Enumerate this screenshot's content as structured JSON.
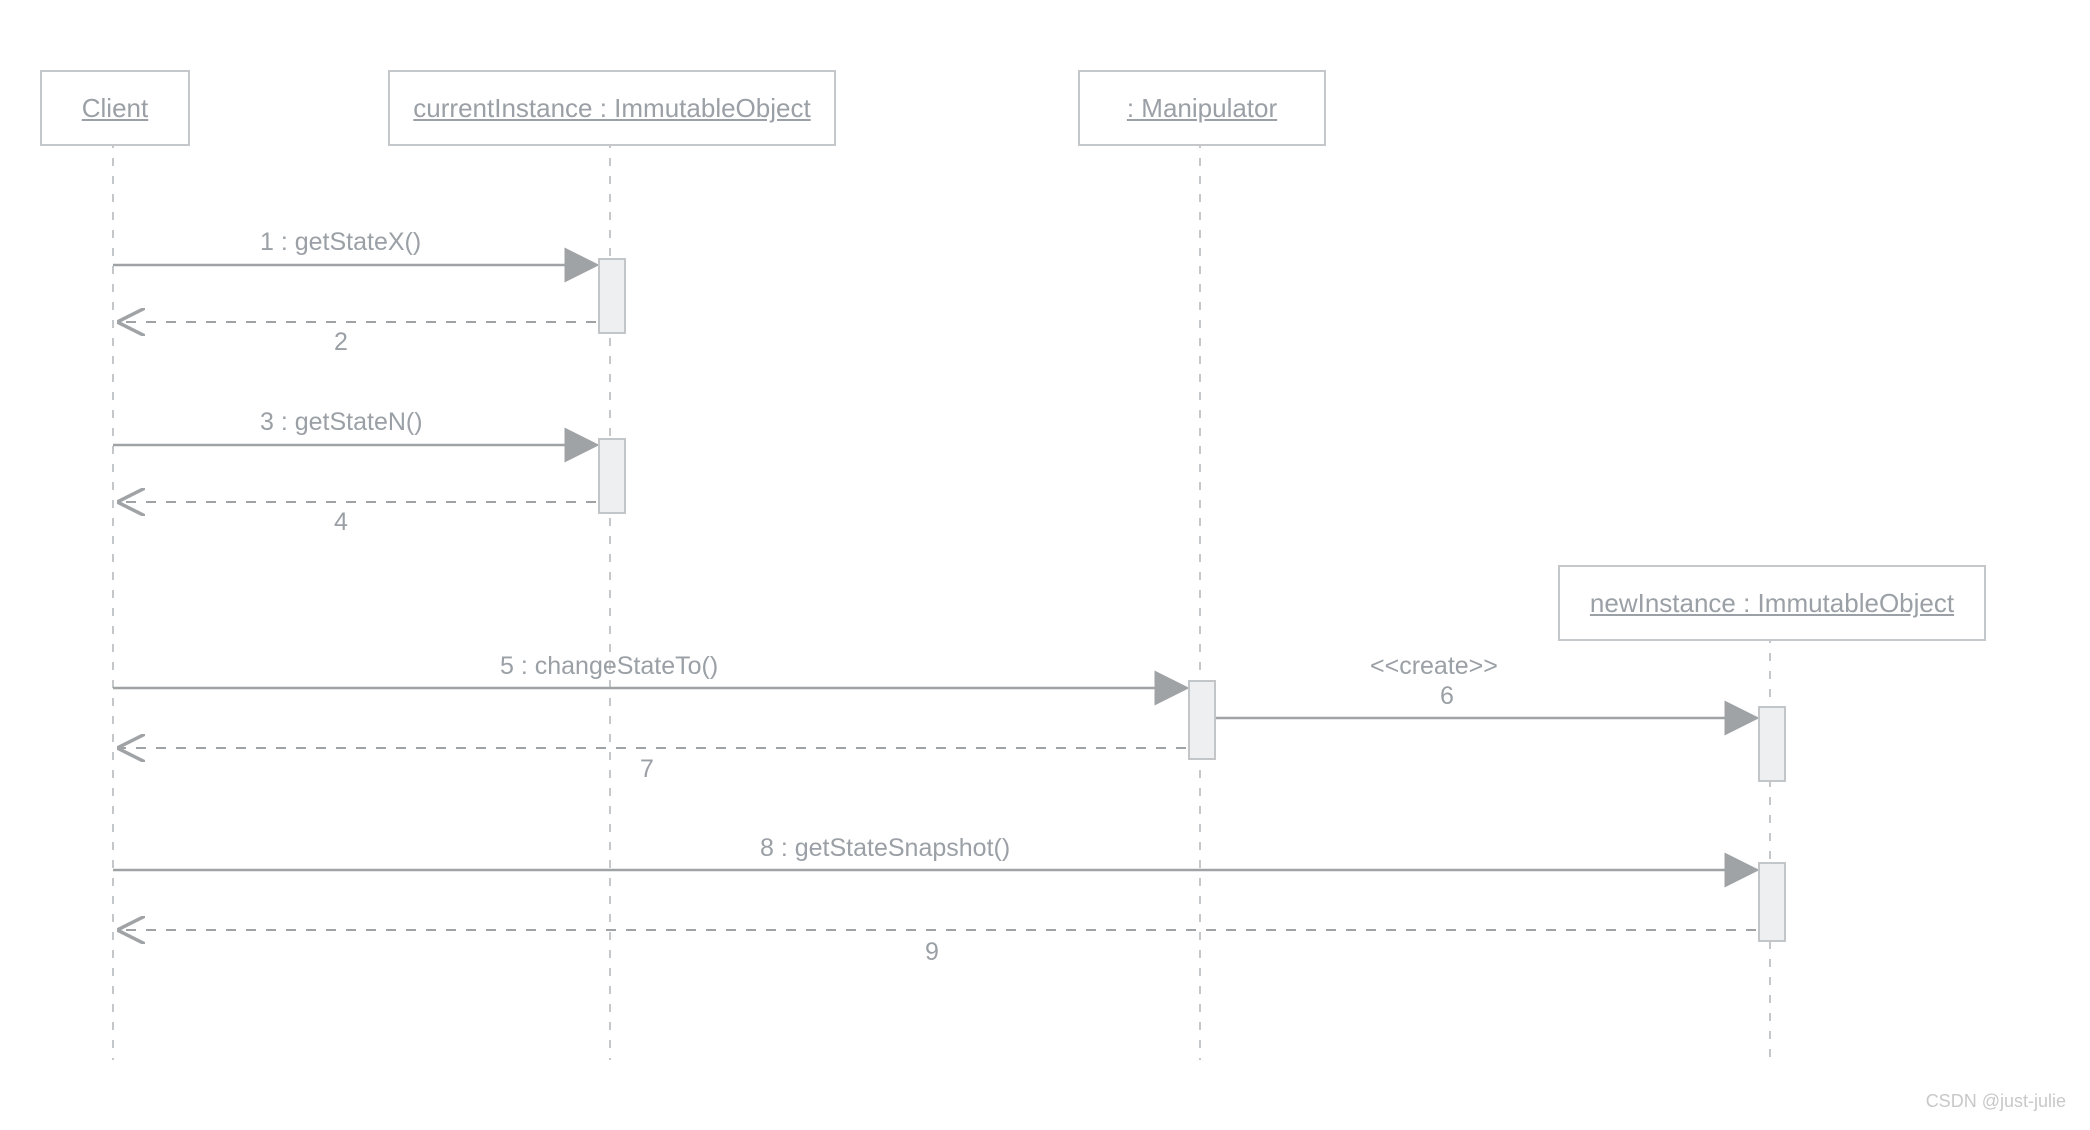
{
  "lifelines": {
    "client": "Client",
    "currentInstance": "currentInstance : ImmutableObject",
    "manipulator": ": Manipulator",
    "newInstance": "newInstance : ImmutableObject"
  },
  "messages": {
    "m1": "1 : getStateX()",
    "r2": "2",
    "m3": "3 : getStateN()",
    "r4": "4",
    "m5": "5 : changeStateTo()",
    "m6_stereo": "<<create>>",
    "m6_num": "6",
    "r7": "7",
    "m8": "8 : getStateSnapshot()",
    "r9": "9"
  },
  "watermark": "CSDN @just-julie",
  "colors": {
    "line": "#c5c8ca",
    "text": "#9aa0a5",
    "activationFill": "#eeeff0"
  }
}
